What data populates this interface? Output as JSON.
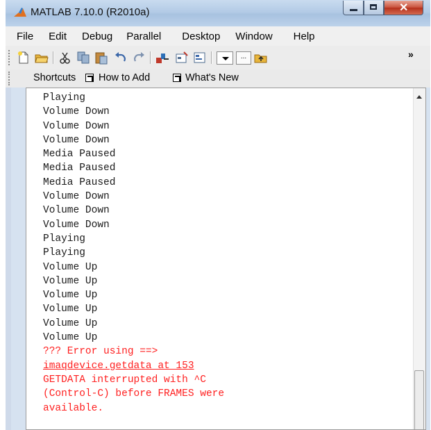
{
  "window": {
    "title": "MATLAB  7.10.0 (R2010a)",
    "controls": {
      "minimize": "minimize",
      "maximize": "maximize",
      "close": "✕"
    }
  },
  "menu": [
    "File",
    "Edit",
    "Debug",
    "Parallel",
    "Desktop",
    "Window",
    "Help"
  ],
  "toolbar": {
    "ellipsis_label": "...",
    "overflow_label": "»",
    "icons": [
      "new-file-icon",
      "open-folder-icon",
      "cut-icon",
      "copy-icon",
      "paste-icon",
      "undo-icon",
      "redo-icon",
      "simulink-icon",
      "guide-icon",
      "profiler-icon",
      "current-folder-dropdown",
      "browse-folder-button",
      "parent-folder-icon"
    ]
  },
  "shortcuts": {
    "label": "Shortcuts",
    "items": [
      "How to Add",
      "What's New"
    ]
  },
  "command_window": {
    "lines": [
      {
        "text": "Playing",
        "type": "output"
      },
      {
        "text": "Volume Down",
        "type": "output"
      },
      {
        "text": "Volume Down",
        "type": "output"
      },
      {
        "text": "Volume Down",
        "type": "output"
      },
      {
        "text": "Media Paused",
        "type": "output"
      },
      {
        "text": "Media Paused",
        "type": "output"
      },
      {
        "text": "Media Paused",
        "type": "output"
      },
      {
        "text": "Volume Down",
        "type": "output"
      },
      {
        "text": "Volume Down",
        "type": "output"
      },
      {
        "text": "Volume Down",
        "type": "output"
      },
      {
        "text": "Playing",
        "type": "output"
      },
      {
        "text": "Playing",
        "type": "output"
      },
      {
        "text": "Volume Up",
        "type": "output"
      },
      {
        "text": "Volume Up",
        "type": "output"
      },
      {
        "text": "Volume Up",
        "type": "output"
      },
      {
        "text": "Volume Up",
        "type": "output"
      },
      {
        "text": "Volume Up",
        "type": "output"
      },
      {
        "text": "Volume Up",
        "type": "output"
      },
      {
        "text": "??? Error using ==>",
        "type": "error"
      },
      {
        "text": "imaqdevice.getdata at 153",
        "type": "error-link"
      },
      {
        "text": "GETDATA interrupted with ^C",
        "type": "error"
      },
      {
        "text": "(Control-C) before FRAMES were",
        "type": "error"
      },
      {
        "text": "available.",
        "type": "error"
      }
    ]
  },
  "colors": {
    "error": "#ff1f1f",
    "output": "#1a1a1a",
    "titlebar": "#b3cbe6",
    "close_button": "#c8503a"
  }
}
